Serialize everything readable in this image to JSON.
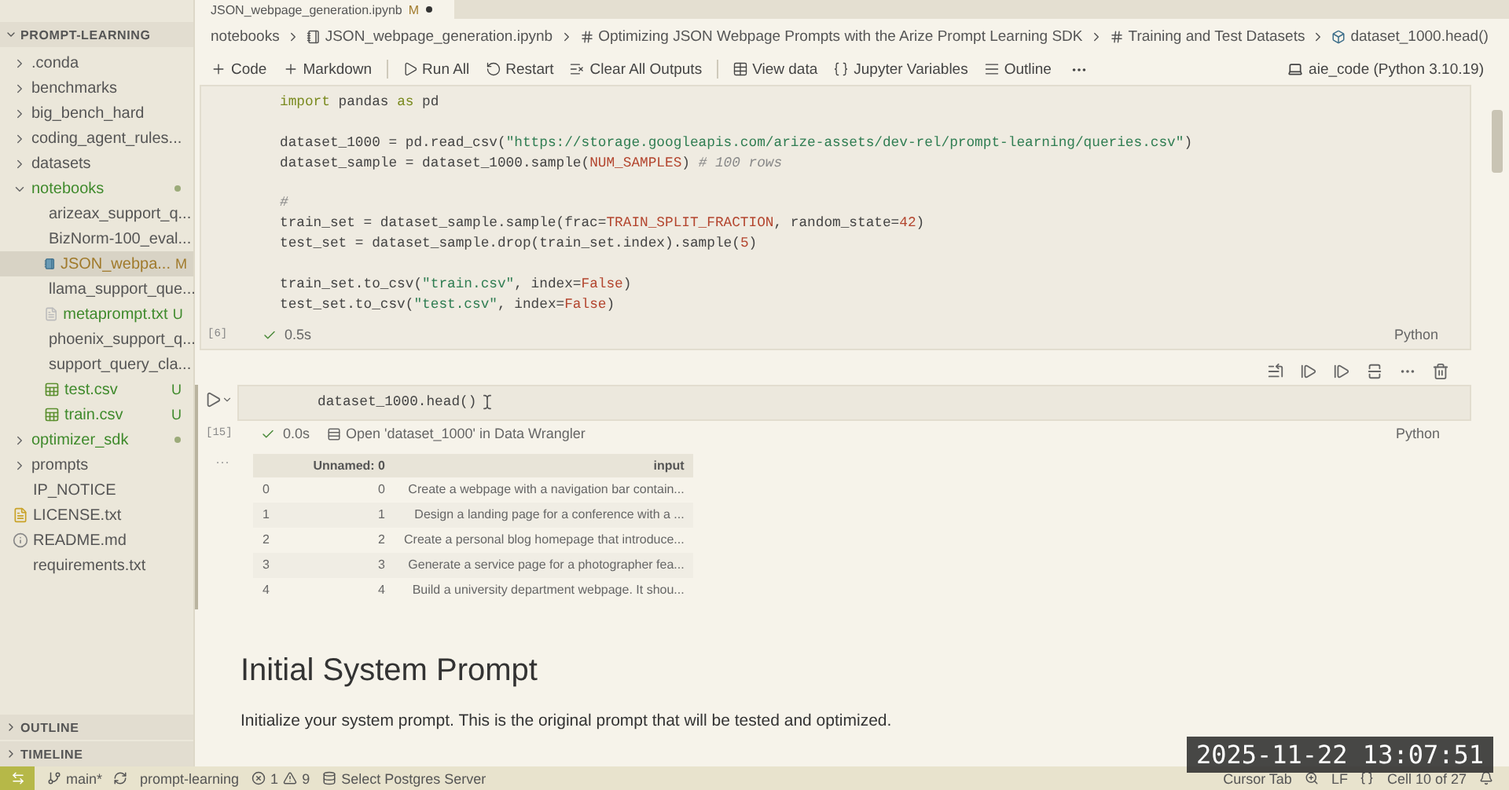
{
  "editor_tab": {
    "title": "JSON_webpage_generation.ipynb",
    "badge": "M",
    "dirty": true
  },
  "explorer": {
    "title": "PROMPT-LEARNING",
    "expanded": true,
    "items": [
      {
        "name": ".conda",
        "kind": "folder",
        "expanded": false,
        "modified": false,
        "untracked": false,
        "has_changes": false,
        "selected": false
      },
      {
        "name": "benchmarks",
        "kind": "folder",
        "expanded": false,
        "modified": false,
        "untracked": false,
        "has_changes": false,
        "selected": false
      },
      {
        "name": "big_bench_hard",
        "kind": "folder",
        "expanded": false,
        "modified": false,
        "untracked": false,
        "has_changes": false,
        "selected": false
      },
      {
        "name": "coding_agent_rules...",
        "kind": "folder",
        "expanded": false,
        "modified": false,
        "untracked": false,
        "has_changes": false,
        "selected": false
      },
      {
        "name": "datasets",
        "kind": "folder",
        "expanded": false,
        "modified": false,
        "untracked": false,
        "has_changes": false,
        "selected": false
      },
      {
        "name": "notebooks",
        "kind": "folder",
        "expanded": true,
        "modified": false,
        "untracked": false,
        "has_changes": true,
        "selected": false,
        "children": [
          {
            "name": "arizeax_support_q...",
            "kind": "notebook",
            "modified": false,
            "untracked": false,
            "has_changes": false,
            "selected": false
          },
          {
            "name": "BizNorm-100_eval...",
            "kind": "notebook",
            "modified": false,
            "untracked": false,
            "has_changes": false,
            "selected": false
          },
          {
            "name": "JSON_webpa...",
            "kind": "notebook",
            "modified": true,
            "untracked": false,
            "has_changes": false,
            "badge": "M",
            "selected": true
          },
          {
            "name": "llama_support_que...",
            "kind": "notebook",
            "modified": false,
            "untracked": false,
            "has_changes": false,
            "selected": false
          },
          {
            "name": "metaprompt.txt",
            "kind": "text",
            "modified": false,
            "untracked": true,
            "has_changes": false,
            "badge": "U",
            "selected": false
          },
          {
            "name": "phoenix_support_q...",
            "kind": "notebook",
            "modified": false,
            "untracked": false,
            "has_changes": false,
            "selected": false
          },
          {
            "name": "support_query_cla...",
            "kind": "notebook",
            "modified": false,
            "untracked": false,
            "has_changes": false,
            "selected": false
          },
          {
            "name": "test.csv",
            "kind": "csv",
            "modified": false,
            "untracked": true,
            "has_changes": false,
            "badge": "U",
            "selected": false
          },
          {
            "name": "train.csv",
            "kind": "csv",
            "modified": false,
            "untracked": true,
            "has_changes": false,
            "badge": "U",
            "selected": false
          }
        ]
      },
      {
        "name": "optimizer_sdk",
        "kind": "folder",
        "expanded": false,
        "modified": false,
        "untracked": false,
        "has_changes": true,
        "selected": false
      },
      {
        "name": "prompts",
        "kind": "folder",
        "expanded": false,
        "modified": false,
        "untracked": false,
        "has_changes": false,
        "selected": false
      },
      {
        "name": "IP_NOTICE",
        "kind": "plain",
        "modified": false,
        "untracked": false,
        "has_changes": false,
        "selected": false
      },
      {
        "name": "LICENSE.txt",
        "kind": "license",
        "modified": false,
        "untracked": false,
        "has_changes": false,
        "selected": false
      },
      {
        "name": "README.md",
        "kind": "info",
        "modified": false,
        "untracked": false,
        "has_changes": false,
        "selected": false
      },
      {
        "name": "requirements.txt",
        "kind": "plain",
        "modified": false,
        "untracked": false,
        "has_changes": false,
        "selected": false
      }
    ]
  },
  "panels": [
    {
      "title": "OUTLINE",
      "expanded": false
    },
    {
      "title": "TIMELINE",
      "expanded": false
    }
  ],
  "breadcrumb": [
    {
      "text": "notebooks",
      "kind": "folder"
    },
    {
      "text": "JSON_webpage_generation.ipynb",
      "kind": "notebook"
    },
    {
      "text": "Optimizing JSON Webpage Prompts with the Arize Prompt Learning SDK",
      "kind": "markdown"
    },
    {
      "text": "Training and Test Datasets",
      "kind": "markdown"
    },
    {
      "text": "dataset_1000.head()",
      "kind": "symbol"
    }
  ],
  "toolbar": [
    [
      {
        "label": "Code"
      },
      {
        "label": "Markdown"
      }
    ],
    [
      {
        "label": "Run All"
      },
      {
        "label": "Restart"
      },
      {
        "label": "Clear All Outputs"
      }
    ],
    [
      {
        "label": "View data"
      },
      {
        "label": "Jupyter Variables"
      },
      {
        "label": "Outline"
      }
    ]
  ],
  "kernel": "aie_code (Python 3.10.19)",
  "cells": [
    {
      "kind": "code",
      "active": false,
      "count": "[6]",
      "time": "0.5s",
      "language": "Python",
      "blocks": [
        [
          {
            "tokens": [
              {
                "kind": "kw",
                "text": "import"
              },
              {
                "kind": "p",
                "text": " pandas "
              },
              {
                "kind": "kw",
                "text": "as"
              },
              {
                "kind": "p",
                "text": " pd"
              }
            ]
          }
        ],
        [
          {
            "tokens": [
              {
                "kind": "p",
                "text": "dataset_1000 = pd.read_csv("
              },
              {
                "kind": "str",
                "text": "\"https://storage.googleapis.com/arize-assets/dev-rel/prompt-learning/queries.csv\""
              },
              {
                "kind": "p",
                "text": ")"
              }
            ]
          },
          {
            "tokens": [
              {
                "kind": "p",
                "text": "dataset_sample = dataset_1000.sample("
              },
              {
                "kind": "const",
                "text": "NUM_SAMPLES"
              },
              {
                "kind": "p",
                "text": ") "
              },
              {
                "kind": "cm",
                "text": "# 100 rows"
              }
            ]
          }
        ],
        [
          {
            "tokens": [
              {
                "kind": "cm",
                "text": "#"
              }
            ]
          },
          {
            "tokens": [
              {
                "kind": "p",
                "text": "train_set = dataset_sample.sample(frac="
              },
              {
                "kind": "const",
                "text": "TRAIN_SPLIT_FRACTION"
              },
              {
                "kind": "p",
                "text": ", random_state="
              },
              {
                "kind": "const",
                "text": "42"
              },
              {
                "kind": "p",
                "text": ")"
              }
            ]
          },
          {
            "tokens": [
              {
                "kind": "p",
                "text": "test_set = dataset_sample.drop(train_set.index).sample("
              },
              {
                "kind": "const",
                "text": "5"
              },
              {
                "kind": "p",
                "text": ")"
              }
            ]
          }
        ],
        [
          {
            "tokens": [
              {
                "kind": "p",
                "text": "train_set.to_csv("
              },
              {
                "kind": "str",
                "text": "\"train.csv\""
              },
              {
                "kind": "p",
                "text": ", index="
              },
              {
                "kind": "const",
                "text": "False"
              },
              {
                "kind": "p",
                "text": ")"
              }
            ]
          },
          {
            "tokens": [
              {
                "kind": "p",
                "text": "test_set.to_csv("
              },
              {
                "kind": "str",
                "text": "\"test.csv\""
              },
              {
                "kind": "p",
                "text": ", index="
              },
              {
                "kind": "const",
                "text": "False"
              },
              {
                "kind": "p",
                "text": ")"
              }
            ]
          }
        ]
      ]
    },
    {
      "kind": "code",
      "active": true,
      "count": "[15]",
      "time": "0.0s",
      "link": "Open 'dataset_1000' in Data Wrangler",
      "language": "Python",
      "blocks": [
        [
          {
            "tokens": [
              {
                "kind": "p",
                "text": "dataset_1000.head()"
              }
            ]
          }
        ]
      ],
      "output": {
        "menu": "···",
        "columns": [
          "",
          "Unnamed: 0",
          "input"
        ],
        "rows": [
          [
            "0",
            "0",
            "Create a webpage with a navigation bar contain..."
          ],
          [
            "1",
            "1",
            "Design a landing page for a conference with a ..."
          ],
          [
            "2",
            "2",
            "Create a personal blog homepage that introduce..."
          ],
          [
            "3",
            "3",
            "Generate a service page for a photographer fea..."
          ],
          [
            "4",
            "4",
            "Build a university department webpage. It shou..."
          ]
        ]
      }
    },
    {
      "kind": "markdown",
      "heading": "Initial System Prompt",
      "paragraph": "Initialize your system prompt. This is the original prompt that will be tested and optimized."
    }
  ],
  "status_bar": {
    "branch": "main*",
    "project": "prompt-learning",
    "errors": "1",
    "warnings": "9",
    "database": "Select Postgres Server",
    "cursor": "Cursor Tab",
    "eol": "LF",
    "cell": "Cell 10 of 27"
  },
  "timestamp": "2025-11-22 13:07:51"
}
